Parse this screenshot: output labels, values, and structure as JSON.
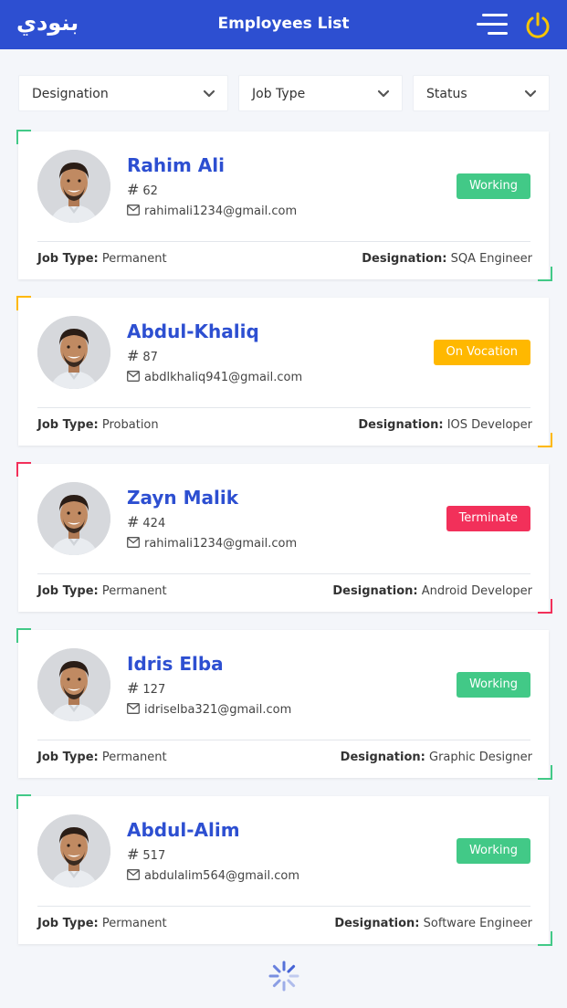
{
  "header": {
    "logo_text": "بنودي",
    "title": "Employees List",
    "menu_icon": "hamburger-menu-icon",
    "power_icon": "power-icon",
    "power_color": "#f6c500",
    "bg_color": "#2d4fd1"
  },
  "filters": [
    {
      "label": "Designation"
    },
    {
      "label": "Job Type"
    },
    {
      "label": "Status"
    }
  ],
  "labels": {
    "job_type": "Job Type:",
    "designation": "Designation:",
    "hash": "#"
  },
  "status_colors": {
    "Working": "#42c987",
    "On Vocation": "#ffb800",
    "Terminate": "#f2305a"
  },
  "employees": [
    {
      "name": "Rahim Ali",
      "id": "62",
      "email": "rahimali1234@gmail.com",
      "status": "Working",
      "job_type": "Permanent",
      "designation": "SQA Engineer",
      "accent": "#42c987"
    },
    {
      "name": "Abdul-Khaliq",
      "id": "87",
      "email": "abdlkhaliq941@gmail.com",
      "status": "On Vocation",
      "job_type": "Probation",
      "designation": "IOS Developer",
      "accent": "#ffb800"
    },
    {
      "name": "Zayn Malik",
      "id": "424",
      "email": "rahimali1234@gmail.com",
      "status": "Terminate",
      "job_type": "Permanent",
      "designation": "Android Developer",
      "accent": "#f2305a"
    },
    {
      "name": "Idris Elba",
      "id": "127",
      "email": "idriselba321@gmail.com",
      "status": "Working",
      "job_type": "Permanent",
      "designation": "Graphic Designer",
      "accent": "#42c987"
    },
    {
      "name": "Abdul-Alim",
      "id": "517",
      "email": "abdulalim564@gmail.com",
      "status": "Working",
      "job_type": "Permanent",
      "designation": "Software Engineer",
      "accent": "#42c987"
    }
  ],
  "loading_icon": "loading-spinner-icon"
}
